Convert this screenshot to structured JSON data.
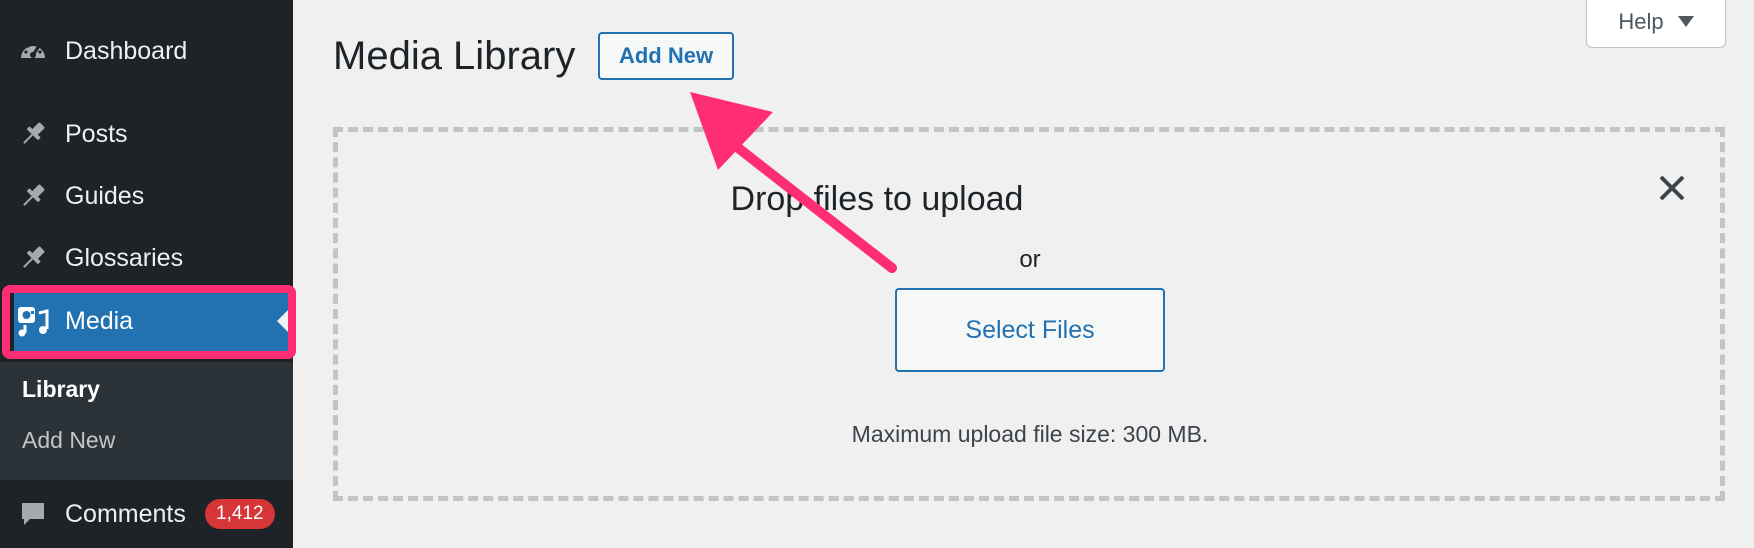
{
  "sidebar": {
    "items": [
      {
        "label": "Dashboard",
        "icon": "dashboard-icon"
      },
      {
        "label": "Posts",
        "icon": "pin-icon"
      },
      {
        "label": "Guides",
        "icon": "pin-icon"
      },
      {
        "label": "Glossaries",
        "icon": "pin-icon"
      },
      {
        "label": "Media",
        "icon": "media-icon",
        "current": true
      },
      {
        "label": "Comments",
        "icon": "comment-icon",
        "badge": "1,412"
      }
    ],
    "submenu": [
      {
        "label": "Library",
        "current": true
      },
      {
        "label": "Add New"
      }
    ]
  },
  "header": {
    "title": "Media Library",
    "add_new_label": "Add New",
    "help_label": "Help"
  },
  "uploader": {
    "title": "Drop files to upload",
    "or_text": "or",
    "select_button": "Select Files",
    "max_size_text": "Maximum upload file size: 300 MB."
  },
  "colors": {
    "sidebar_bg": "#1d2327",
    "accent": "#2271b1",
    "annotation": "#ff2d74",
    "badge": "#d63638"
  }
}
